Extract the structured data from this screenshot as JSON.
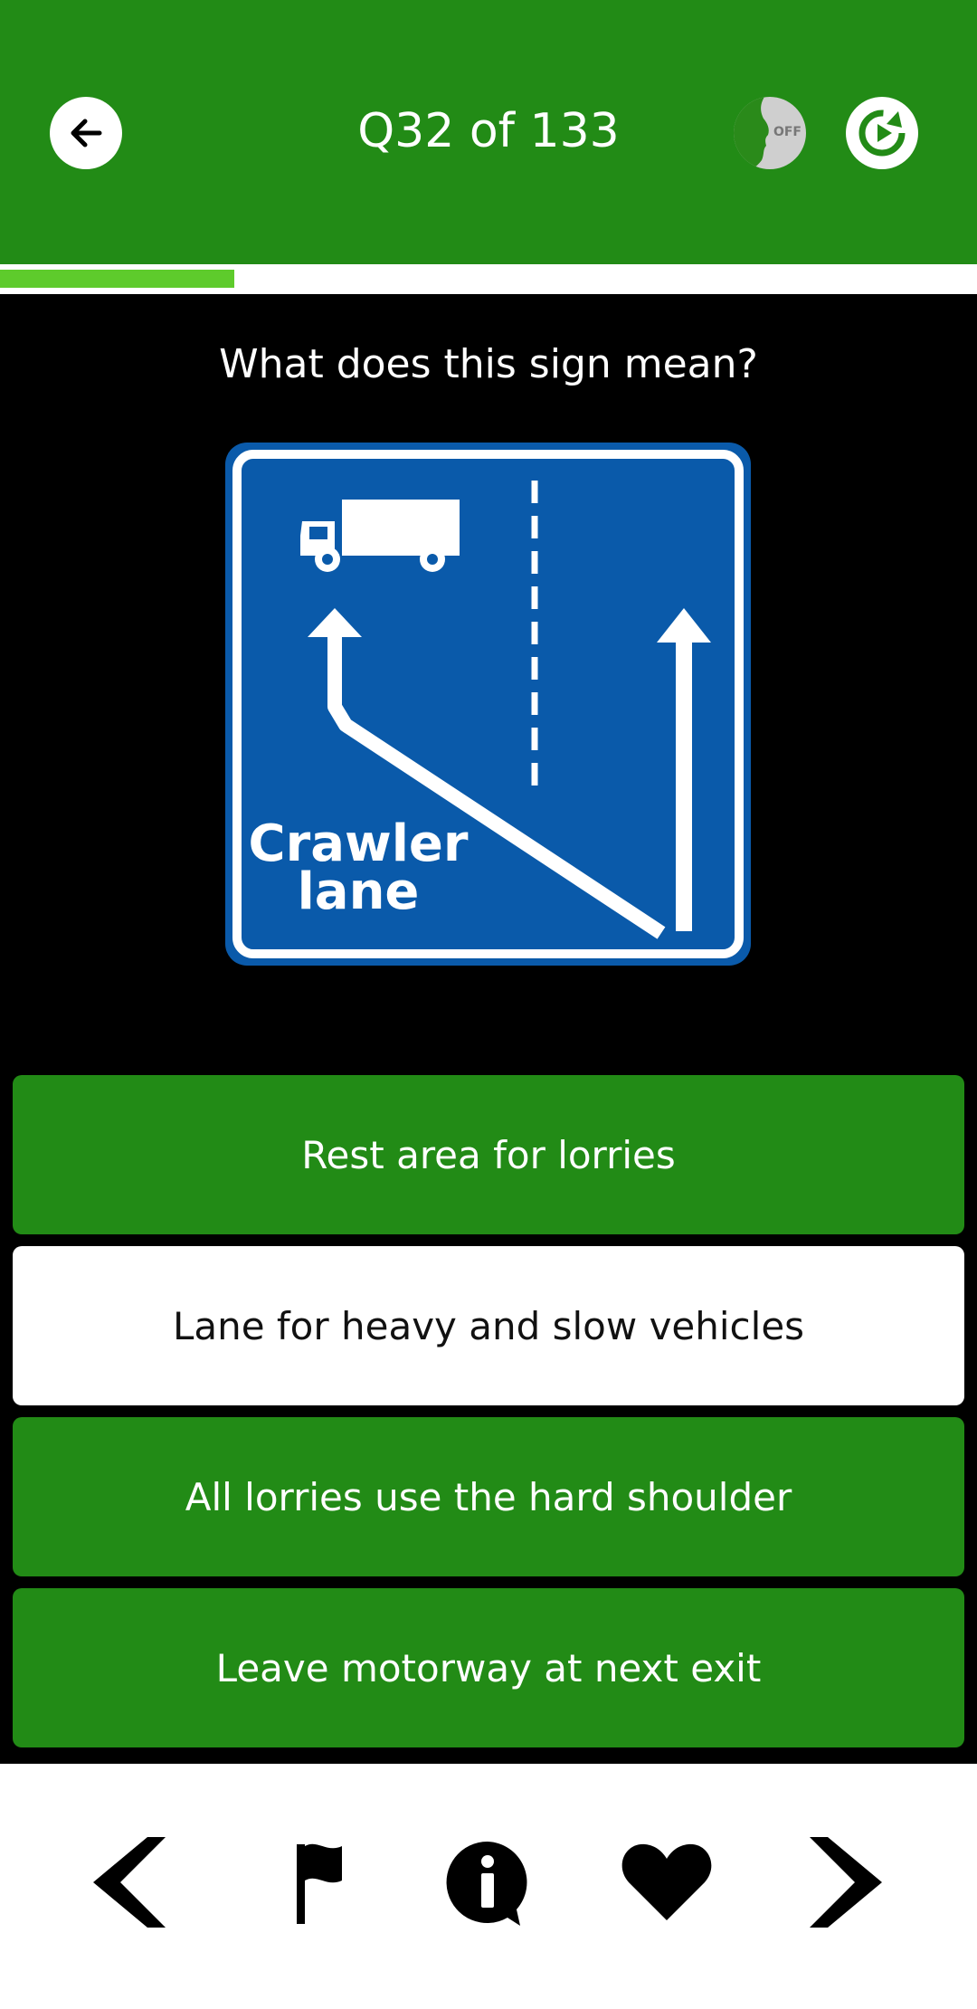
{
  "header": {
    "title": "Q32 of 133",
    "voice_toggle_text": "OFF",
    "colors": {
      "header_bg": "#228B16",
      "progress": "#5ECB2C",
      "sign_blue": "#0A5AAA"
    }
  },
  "progress": {
    "current": 32,
    "total": 133,
    "fraction": 0.24
  },
  "question": {
    "text": "What does this sign mean?",
    "sign_text_line1": "Crawler",
    "sign_text_line2": "lane"
  },
  "answers": [
    {
      "label": "Rest area for lorries",
      "selected": false
    },
    {
      "label": "Lane for heavy and slow vehicles",
      "selected": true
    },
    {
      "label": "All lorries use the hard shoulder",
      "selected": false
    },
    {
      "label": "Leave motorway at next exit",
      "selected": false
    }
  ],
  "bottom_nav": {
    "icons": [
      "chevron-left-icon",
      "flag-icon",
      "info-icon",
      "heart-icon",
      "chevron-right-icon"
    ]
  }
}
